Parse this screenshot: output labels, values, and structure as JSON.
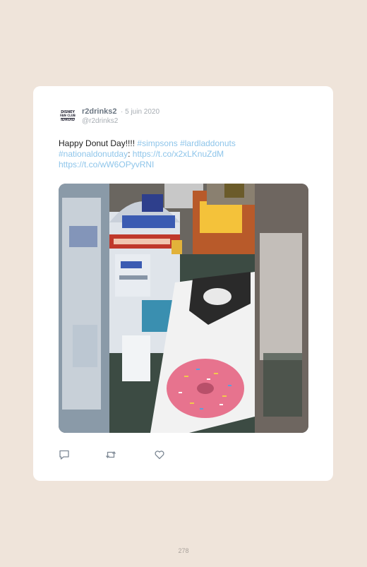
{
  "tweet": {
    "avatar_text": [
      "DISNEY",
      "FAN CLUB",
      "IDROID"
    ],
    "display_name": "r2drinks2",
    "date": "· 5 juin 2020",
    "handle": "@r2drinks2",
    "text_plain": "Happy Donut Day!!!! ",
    "hashtag_1": "#simpsons",
    "hashtag_2": "#lardladdonuts",
    "hashtag_3": "#nationaldonutday",
    "colon": ": ",
    "link_1": "https://t.co/x2xLKnuZdM",
    "link_2": "https://t.co/wW6OPyvRNI"
  },
  "actions": {
    "reply_icon": "reply-icon",
    "retweet_icon": "retweet-icon",
    "like_icon": "heart-icon"
  },
  "colors": {
    "page_bg": "#efe4da",
    "card_bg": "#ffffff",
    "link": "#8ec5ea",
    "muted": "#a7adb3"
  },
  "page_number": "278"
}
